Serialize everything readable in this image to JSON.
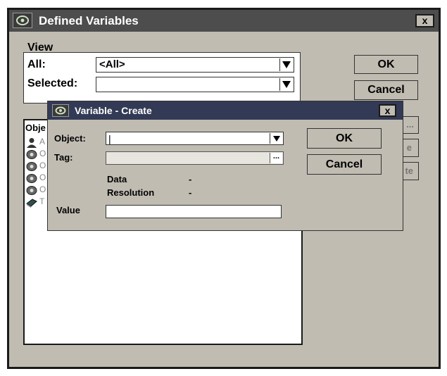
{
  "outer": {
    "title": "Defined Variables",
    "close_label": "x",
    "view_group_label": "View",
    "all_label": "All:",
    "all_value": "<All>",
    "selected_label": "Selected:",
    "selected_value": "",
    "ok_label": "OK",
    "cancel_label": "Cancel",
    "list_header": "Obje",
    "side_buttons": [
      "...",
      "e",
      "te"
    ],
    "list_rows": [
      {
        "icon": "person-icon",
        "text": "A"
      },
      {
        "icon": "gear-object-icon",
        "text": "O"
      },
      {
        "icon": "gear-object-icon",
        "text": "O"
      },
      {
        "icon": "gear-object-icon",
        "text": "O"
      },
      {
        "icon": "gear-object-icon",
        "text": "O"
      },
      {
        "icon": "book-icon",
        "text": "T"
      }
    ]
  },
  "dialog": {
    "title": "Variable - Create",
    "close_label": "x",
    "object_label": "Object:",
    "object_value": "|",
    "tag_label": "Tag:",
    "tag_browse": "...",
    "data_label": "Data",
    "data_value": "-",
    "resolution_label": "Resolution",
    "resolution_value": "-",
    "value_label": "Value",
    "value_value": "",
    "ok_label": "OK",
    "cancel_label": "Cancel"
  }
}
